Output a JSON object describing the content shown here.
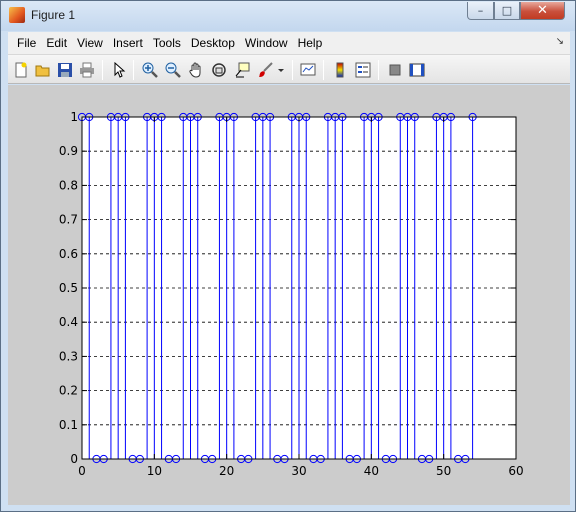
{
  "window": {
    "title": "Figure 1",
    "controls": {
      "minimize": "–",
      "maximize": "□",
      "close": "✕"
    }
  },
  "menu": {
    "items": [
      "File",
      "Edit",
      "View",
      "Insert",
      "Tools",
      "Desktop",
      "Window",
      "Help"
    ],
    "overflow_icon": "dock-arrow-icon"
  },
  "toolbar": {
    "buttons": [
      "new-figure-icon",
      "open-file-icon",
      "save-icon",
      "print-icon",
      "edit-plot-arrow-icon",
      "zoom-in-icon",
      "zoom-out-icon",
      "pan-hand-icon",
      "rotate-3d-icon",
      "data-cursor-icon",
      "brush-icon",
      "brush-dropdown-icon",
      "link-plot-icon",
      "colorbar-icon",
      "legend-icon",
      "hide-plot-tools-icon",
      "show-plot-tools-icon"
    ]
  },
  "colors": {
    "series": "#0000ff",
    "figure_background": "#cccccc",
    "axes_background": "#ffffff"
  },
  "chart_data": {
    "type": "stem",
    "xlim": [
      0,
      60
    ],
    "ylim": [
      0,
      1
    ],
    "xticks": [
      0,
      10,
      20,
      30,
      40,
      50,
      60
    ],
    "yticks": [
      0,
      0.1,
      0.2,
      0.3,
      0.4,
      0.5,
      0.6,
      0.7,
      0.8,
      0.9,
      1
    ],
    "ytick_labels": [
      "0",
      "0.1",
      "0.2",
      "0.3",
      "0.4",
      "0.5",
      "0.6",
      "0.7",
      "0.8",
      "0.9",
      "1"
    ],
    "ygrid": true,
    "grid_style": "dashed",
    "marker": "open-circle",
    "x": [
      0,
      1,
      2,
      3,
      4,
      5,
      6,
      7,
      8,
      9,
      10,
      11,
      12,
      13,
      14,
      15,
      16,
      17,
      18,
      19,
      20,
      21,
      22,
      23,
      24,
      25,
      26,
      27,
      28,
      29,
      30,
      31,
      32,
      33,
      34,
      35,
      36,
      37,
      38,
      39,
      40,
      41,
      42,
      43,
      44,
      45,
      46,
      47,
      48,
      49,
      50,
      51,
      52,
      53,
      54
    ],
    "y": [
      1,
      1,
      0,
      0,
      1,
      1,
      1,
      0,
      0,
      1,
      1,
      1,
      0,
      0,
      1,
      1,
      1,
      0,
      0,
      1,
      1,
      1,
      0,
      0,
      1,
      1,
      1,
      0,
      0,
      1,
      1,
      1,
      0,
      0,
      1,
      1,
      1,
      0,
      0,
      1,
      1,
      1,
      0,
      0,
      1,
      1,
      1,
      0,
      0,
      1,
      1,
      1,
      0,
      0,
      1
    ]
  }
}
